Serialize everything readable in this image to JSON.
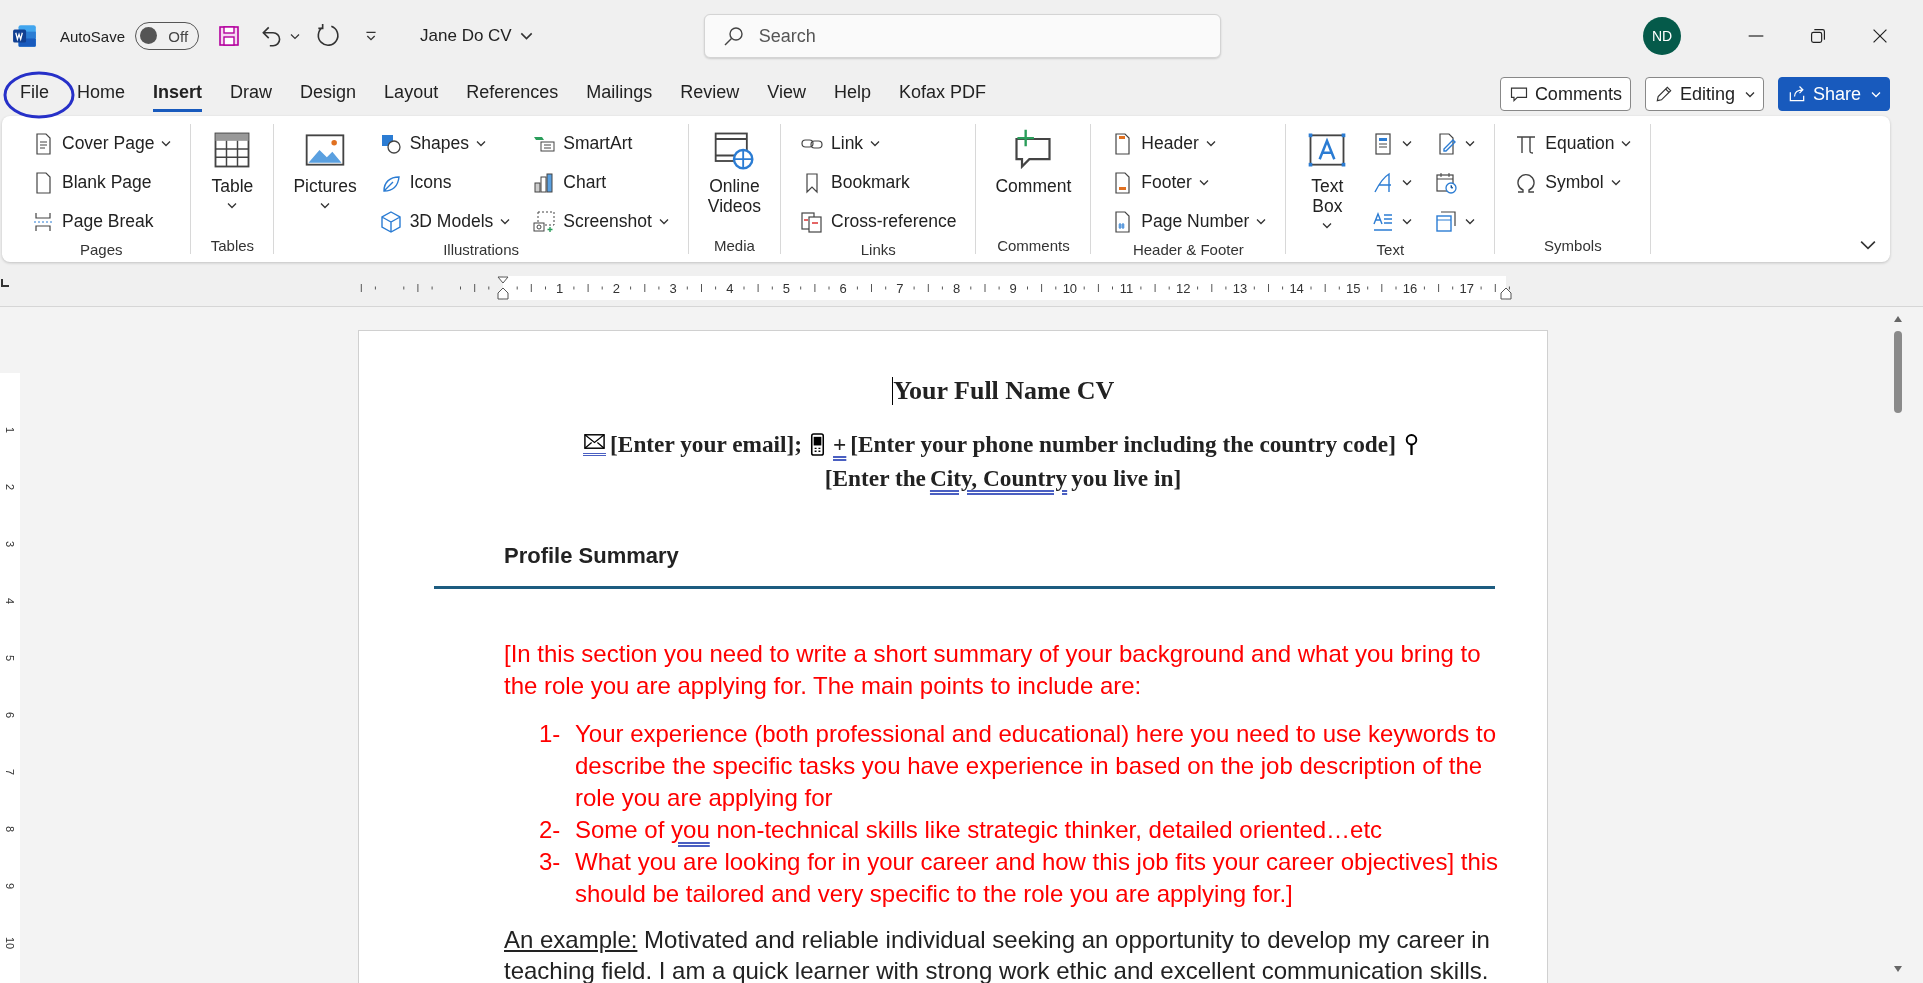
{
  "title_bar": {
    "autosave_label": "AutoSave",
    "autosave": {
      "on": false,
      "text": "Off"
    },
    "document_name": "Jane Do CV",
    "search": {
      "placeholder": "Search"
    },
    "account_initials": "ND"
  },
  "tabs": [
    {
      "label": "File",
      "selected": false,
      "circled": true
    },
    {
      "label": "Home",
      "selected": false,
      "circled": false
    },
    {
      "label": "Insert",
      "selected": true,
      "circled": false
    },
    {
      "label": "Draw",
      "selected": false,
      "circled": false
    },
    {
      "label": "Design",
      "selected": false,
      "circled": false
    },
    {
      "label": "Layout",
      "selected": false,
      "circled": false
    },
    {
      "label": "References",
      "selected": false,
      "circled": false
    },
    {
      "label": "Mailings",
      "selected": false,
      "circled": false
    },
    {
      "label": "Review",
      "selected": false,
      "circled": false
    },
    {
      "label": "View",
      "selected": false,
      "circled": false
    },
    {
      "label": "Help",
      "selected": false,
      "circled": false
    },
    {
      "label": "Kofax PDF",
      "selected": false,
      "circled": false
    }
  ],
  "actions": [
    {
      "kind": "comments",
      "label": "Comments"
    },
    {
      "kind": "editing",
      "label": "Editing"
    },
    {
      "kind": "share",
      "label": "Share"
    }
  ],
  "ribbon": {
    "groups": [
      {
        "label": "Pages",
        "columns": [
          {
            "kind": "stack",
            "items": [
              {
                "label": "Cover Page",
                "dropdown": true
              },
              {
                "label": "Blank Page",
                "dropdown": false
              },
              {
                "label": "Page Break",
                "dropdown": false
              }
            ]
          }
        ]
      },
      {
        "label": "Tables",
        "columns": [
          {
            "kind": "large",
            "items": [
              {
                "label": "Table",
                "dropdown": true
              }
            ]
          }
        ]
      },
      {
        "label": "Illustrations",
        "columns": [
          {
            "kind": "large",
            "items": [
              {
                "label": "Pictures",
                "dropdown": true
              }
            ]
          },
          {
            "kind": "stack",
            "items": [
              {
                "label": "Shapes",
                "dropdown": true
              },
              {
                "label": "Icons",
                "dropdown": false
              },
              {
                "label": "3D Models",
                "dropdown": true
              }
            ]
          },
          {
            "kind": "stack",
            "items": [
              {
                "label": "SmartArt",
                "dropdown": false
              },
              {
                "label": "Chart",
                "dropdown": false
              },
              {
                "label": "Screenshot",
                "dropdown": true
              }
            ]
          }
        ]
      },
      {
        "label": "Media",
        "columns": [
          {
            "kind": "large",
            "items": [
              {
                "label": "Online Videos",
                "dropdown": false
              }
            ]
          }
        ]
      },
      {
        "label": "Links",
        "columns": [
          {
            "kind": "stack",
            "items": [
              {
                "label": "Link",
                "dropdown": true
              },
              {
                "label": "Bookmark",
                "dropdown": false
              },
              {
                "label": "Cross-reference",
                "dropdown": false
              }
            ]
          }
        ]
      },
      {
        "label": "Comments",
        "columns": [
          {
            "kind": "large",
            "items": [
              {
                "label": "Comment",
                "dropdown": false
              }
            ]
          }
        ]
      },
      {
        "label": "Header & Footer",
        "columns": [
          {
            "kind": "stack",
            "items": [
              {
                "label": "Header",
                "dropdown": true
              },
              {
                "label": "Footer",
                "dropdown": true
              },
              {
                "label": "Page Number",
                "dropdown": true
              }
            ]
          }
        ]
      },
      {
        "label": "Text",
        "columns": [
          {
            "kind": "large",
            "items": [
              {
                "label": "Text Box",
                "dropdown": true
              }
            ]
          },
          {
            "kind": "stack",
            "items": [
              {
                "dropdown": true
              },
              {
                "dropdown": true
              },
              {
                "dropdown": true
              }
            ]
          },
          {
            "kind": "stack",
            "items": [
              {
                "dropdown": true
              },
              {
                "dropdown": false
              },
              {
                "dropdown": true
              }
            ]
          }
        ]
      },
      {
        "label": "Symbols",
        "columns": [
          {
            "kind": "stack",
            "items": [
              {
                "label": "Equation",
                "dropdown": true
              },
              {
                "label": "Symbol",
                "dropdown": true
              }
            ]
          }
        ]
      }
    ]
  },
  "ruler": {
    "numbers": [
      "1",
      "2",
      "3",
      "4",
      "5",
      "6",
      "7",
      "8",
      "9",
      "10",
      "11",
      "12",
      "13",
      "14",
      "15",
      "16",
      "17"
    ]
  },
  "vertical_ruler": {
    "numbers": [
      "1",
      "2",
      "3",
      "4",
      "5",
      "6",
      "7",
      "8",
      "9",
      "10"
    ]
  },
  "document": {
    "title": "Your Full Name CV",
    "contact": [
      {
        "kind": "envelope",
        "flagged": true
      },
      {
        "kind": "text",
        "text": "[Enter your email];",
        "flagged": false
      },
      {
        "kind": "phone",
        "flagged": false
      },
      {
        "kind": "text",
        "text": "+",
        "flagged": true
      },
      {
        "kind": "text",
        "text": "[Enter your phone number including the country code]",
        "flagged": false
      },
      {
        "kind": "pin",
        "flagged": false
      },
      {
        "kind": "text",
        "text": "[Enter the",
        "flagged": false
      },
      {
        "kind": "text",
        "text": "City,  Country",
        "flagged": true
      },
      {
        "kind": "text",
        "text": "you live in]",
        "flagged": false
      }
    ],
    "section_heading": "Profile Summary",
    "intro": "[In this section you need to write a short summary of your background and what you bring to the role you are applying for. The main points to include are:",
    "points": [
      {
        "number": "1-",
        "parts": [
          {
            "text": "Your experience (both professional and educational) here you need to use keywords to describe the specific tasks you have experience in based on the job description of the role you are applying for",
            "flagged": false
          }
        ]
      },
      {
        "number": "2-",
        "parts": [
          {
            "text": "Some of ",
            "flagged": false
          },
          {
            "text": "you",
            "flagged": true
          },
          {
            "text": " non-technical skills like strategic thinker, detailed oriented…etc",
            "flagged": false
          }
        ]
      },
      {
        "number": "3-",
        "parts": [
          {
            "text": "What you are looking for in your career and how this job fits your career objectives] this should be tailored and very specific to the role you are applying for.]",
            "flagged": false
          }
        ]
      }
    ],
    "example": [
      {
        "text": "An example:",
        "underlined": true
      },
      {
        "text": " Motivated and reliable individual seeking an opportunity to develop my career in teaching field. I am a quick learner with strong work ethic and excellent communication skills.",
        "underlined": false
      }
    ]
  }
}
